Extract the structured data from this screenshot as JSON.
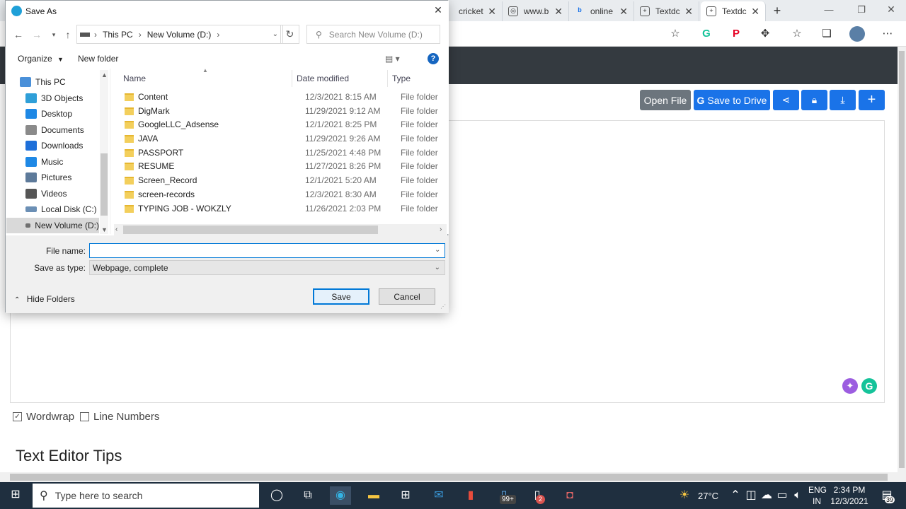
{
  "browser": {
    "tabs": [
      {
        "label": "cricket"
      },
      {
        "label": "www.b"
      },
      {
        "label": "online"
      },
      {
        "label": "Textdc"
      },
      {
        "label": "Textdc"
      }
    ],
    "new_tab_label": "+"
  },
  "toolbar": {
    "open_file": "Open File",
    "save_to_drive": "Save to Drive"
  },
  "editor_options": {
    "wordwrap": {
      "label": "Wordwrap",
      "checked": true
    },
    "line_numbers": {
      "label": "Line Numbers",
      "checked": false
    }
  },
  "page": {
    "tips_heading": "Text Editor Tips"
  },
  "dialog": {
    "title": "Save As",
    "breadcrumb": [
      "This PC",
      "New Volume (D:)"
    ],
    "search_placeholder": "Search New Volume (D:)",
    "organize_label": "Organize",
    "new_folder_label": "New folder",
    "help_label": "?",
    "nav_items": [
      {
        "label": "This PC",
        "icon": "computer-icon",
        "color": "#4a90d9"
      },
      {
        "label": "3D Objects",
        "icon": "cube-icon",
        "color": "#2f9fd8"
      },
      {
        "label": "Desktop",
        "icon": "desktop-icon",
        "color": "#1e88e5"
      },
      {
        "label": "Documents",
        "icon": "document-icon",
        "color": "#8a8a8a"
      },
      {
        "label": "Downloads",
        "icon": "download-icon",
        "color": "#1e6fd9"
      },
      {
        "label": "Music",
        "icon": "music-icon",
        "color": "#1e88e5"
      },
      {
        "label": "Pictures",
        "icon": "pictures-icon",
        "color": "#5d7a9a"
      },
      {
        "label": "Videos",
        "icon": "videos-icon",
        "color": "#555555"
      },
      {
        "label": "Local Disk (C:)",
        "icon": "drive-icon",
        "color": "#6b8fb5"
      },
      {
        "label": "New Volume (D:)",
        "icon": "drive-icon",
        "color": "#707070"
      }
    ],
    "columns": {
      "name": "Name",
      "date_modified": "Date modified",
      "type": "Type"
    },
    "files": [
      {
        "name": "Content",
        "date": "12/3/2021 8:15 AM",
        "type": "File folder"
      },
      {
        "name": "DigMark",
        "date": "11/29/2021 9:12 AM",
        "type": "File folder"
      },
      {
        "name": "GoogleLLC_Adsense",
        "date": "12/1/2021 8:25 PM",
        "type": "File folder"
      },
      {
        "name": "JAVA",
        "date": "11/29/2021 9:26 AM",
        "type": "File folder"
      },
      {
        "name": "PASSPORT",
        "date": "11/25/2021 4:48 PM",
        "type": "File folder"
      },
      {
        "name": "RESUME",
        "date": "11/27/2021 8:26 PM",
        "type": "File folder"
      },
      {
        "name": "Screen_Record",
        "date": "12/1/2021 5:20 AM",
        "type": "File folder"
      },
      {
        "name": "screen-records",
        "date": "12/3/2021 8:30 AM",
        "type": "File folder"
      },
      {
        "name": "TYPING JOB - WOKZLY",
        "date": "11/26/2021 2:03 PM",
        "type": "File folder"
      }
    ],
    "file_name_label": "File name:",
    "file_name_value": "",
    "save_as_type_label": "Save as type:",
    "save_as_type_value": "Webpage, complete",
    "hide_folders_label": "Hide Folders",
    "save_button": "Save",
    "cancel_button": "Cancel"
  },
  "taskbar": {
    "search_placeholder": "Type here to search",
    "badges": {
      "notifications_app": "99+",
      "document_app": "2"
    },
    "weather": "27°C",
    "language": {
      "line1": "ENG",
      "line2": "IN"
    },
    "time": "2:34 PM",
    "date": "12/3/2021",
    "notification_count": "39"
  }
}
